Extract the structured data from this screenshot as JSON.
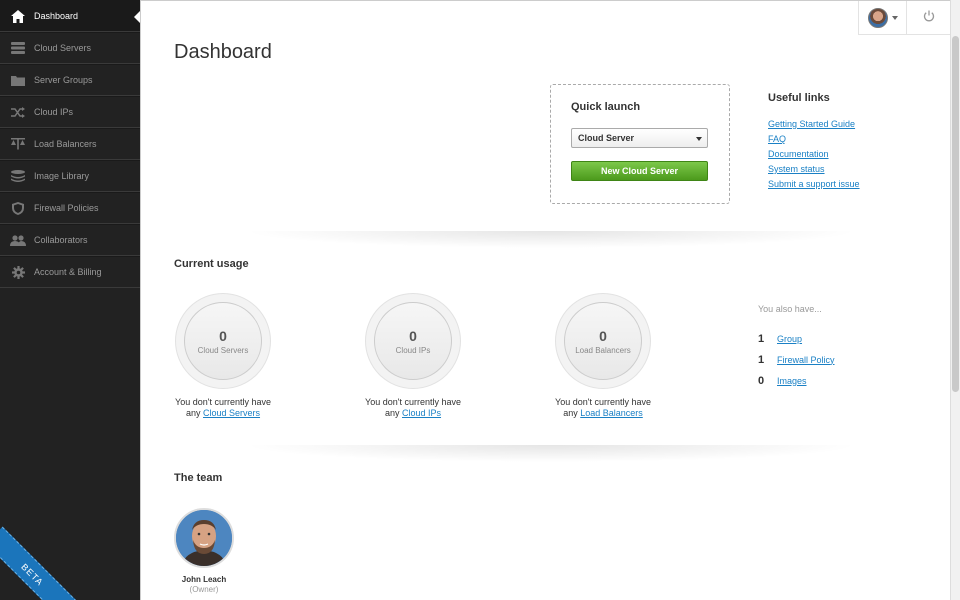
{
  "sidebar": {
    "items": [
      {
        "label": "Dashboard",
        "icon": "home-icon"
      },
      {
        "label": "Cloud Servers",
        "icon": "server-icon"
      },
      {
        "label": "Server Groups",
        "icon": "folder-icon"
      },
      {
        "label": "Cloud IPs",
        "icon": "shuffle-icon"
      },
      {
        "label": "Load Balancers",
        "icon": "balance-icon"
      },
      {
        "label": "Image Library",
        "icon": "stack-icon"
      },
      {
        "label": "Firewall Policies",
        "icon": "shield-icon"
      },
      {
        "label": "Collaborators",
        "icon": "users-icon"
      },
      {
        "label": "Account & Billing",
        "icon": "gear-icon"
      }
    ],
    "beta_label": "BETA"
  },
  "page": {
    "title": "Dashboard"
  },
  "quick_launch": {
    "title": "Quick launch",
    "selected": "Cloud Server",
    "button": "New Cloud Server"
  },
  "useful_links": {
    "title": "Useful links",
    "items": [
      "Getting Started Guide",
      "FAQ",
      "Documentation",
      "System status",
      "Submit a support issue"
    ]
  },
  "usage": {
    "title": "Current usage",
    "cards": [
      {
        "count": "0",
        "label": "Cloud Servers",
        "note": "You don't currently have",
        "note_prefix": "any",
        "link": "Cloud Servers"
      },
      {
        "count": "0",
        "label": "Cloud IPs",
        "note": "You don't currently have",
        "note_prefix": "any",
        "link": "Cloud IPs"
      },
      {
        "count": "0",
        "label": "Load Balancers",
        "note": "You don't currently have",
        "note_prefix": "any",
        "link": "Load Balancers"
      }
    ],
    "also": {
      "heading": "You also have...",
      "items": [
        {
          "count": "1",
          "label": "Group"
        },
        {
          "count": "1",
          "label": "Firewall Policy"
        },
        {
          "count": "0",
          "label": "Images"
        }
      ]
    }
  },
  "team": {
    "title": "The team",
    "members": [
      {
        "name": "John Leach",
        "role": "(Owner)"
      }
    ]
  },
  "colors": {
    "accent_link": "#1a80c5",
    "button_green": "#5aab26",
    "sidebar_bg": "#222222",
    "beta_blue": "#1b75bb"
  }
}
